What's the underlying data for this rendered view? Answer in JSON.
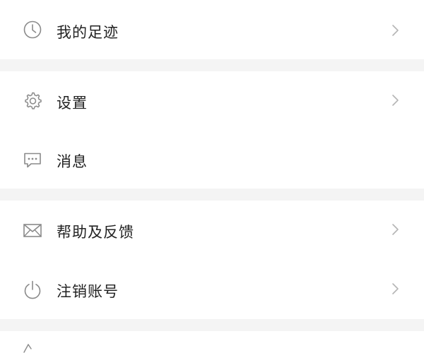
{
  "colors": {
    "background": "#f4f4f4",
    "card": "#ffffff",
    "text": "#222222",
    "icon": "#8a8a8a",
    "chevron": "#b5b5b5"
  },
  "menu": {
    "groups": [
      {
        "items": [
          {
            "label": "我的足迹",
            "icon": "clock-icon",
            "has_chevron": true
          }
        ]
      },
      {
        "items": [
          {
            "label": "设置",
            "icon": "gear-icon",
            "has_chevron": true
          },
          {
            "label": "消息",
            "icon": "message-icon",
            "has_chevron": false
          }
        ]
      },
      {
        "items": [
          {
            "label": "帮助及反馈",
            "icon": "envelope-icon",
            "has_chevron": true
          },
          {
            "label": "注销账号",
            "icon": "power-icon",
            "has_chevron": true
          }
        ]
      },
      {
        "items": [
          {
            "label": "",
            "icon": "partial-icon",
            "has_chevron": false
          }
        ]
      }
    ]
  }
}
